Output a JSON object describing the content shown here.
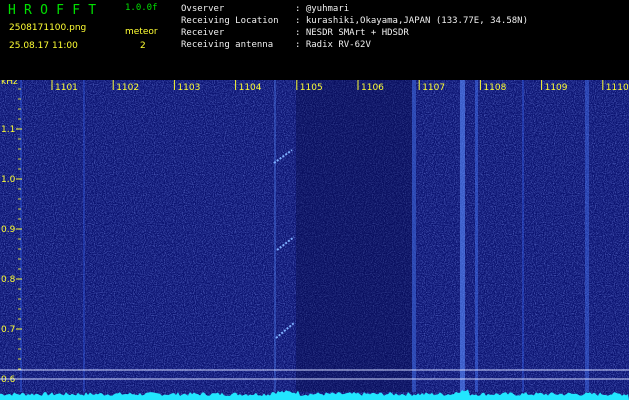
{
  "header": {
    "app_title": "H R O F F T",
    "version": "1.0.0f",
    "filename": "2508171100.png",
    "datetime": "25.08.17 11:00",
    "mode_label": "meteor",
    "meteor_count": "2"
  },
  "station_info": [
    {
      "key": "Ovserver",
      "value": ": @yuhmari"
    },
    {
      "key": "Receiving Location",
      "value": ": kurashiki,Okayama,JAPAN (133.77E, 34.58N)"
    },
    {
      "key": "Receiver",
      "value": ": NESDR SMArt + HDSDR"
    },
    {
      "key": "Receiving antenna",
      "value": ": Radix RV-62V"
    }
  ],
  "axis": {
    "y_unit": "kHz",
    "y_ticks": [
      "1.1",
      "1.0",
      "0.9",
      "0.8",
      "0.7",
      "0.6"
    ],
    "x_ticks": [
      "1101",
      "1102",
      "1103",
      "1104",
      "1105",
      "1106",
      "1107",
      "1108",
      "1109",
      "1110"
    ]
  },
  "colors": {
    "background": "#000000",
    "spectrogram": "#0a1270",
    "label_yellow": "#ffff33",
    "title_green": "#00e000",
    "trace_cyan": "#22e6ff"
  }
}
